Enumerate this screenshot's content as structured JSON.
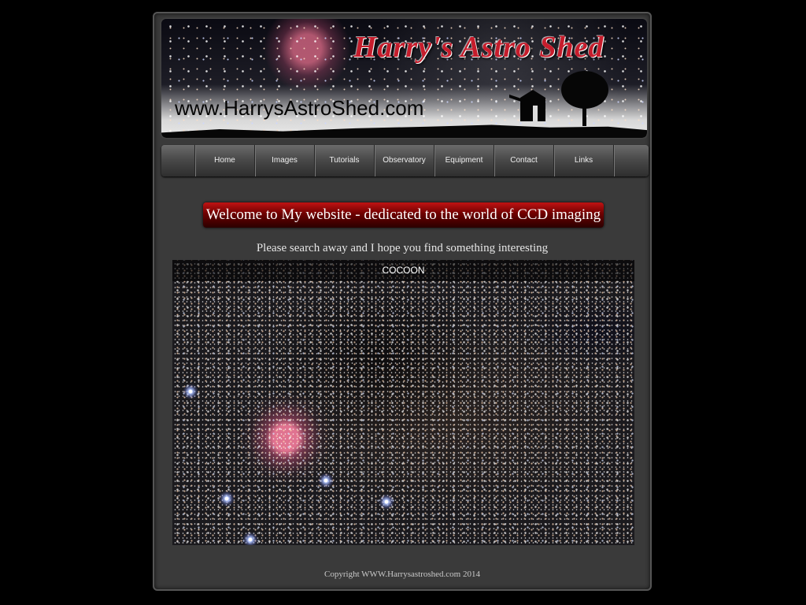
{
  "banner": {
    "title": "Harry's Astro Shed",
    "url": "www.HarrysAstroShed.com"
  },
  "nav": {
    "items": [
      "Home",
      "Images",
      "Tutorials",
      "Observatory",
      "Equipment",
      "Contact",
      "Links"
    ]
  },
  "main": {
    "welcome": "Welcome to My website - dedicated to the world of CCD imaging",
    "subtitle": "Please search away and I hope you find something interesting",
    "slideshow_caption": "COCOON"
  },
  "footer": {
    "copyright": "Copyright WWW.Harrysastroshed.com 2014"
  },
  "colors": {
    "background": "#000000",
    "page": "#3a3a3a",
    "title_red": "#c61d2c",
    "welcome_bar": "#8a0a0a",
    "text": "#e6e6e6"
  },
  "icons": [
    "observatory-shed-silhouette-icon",
    "tree-silhouette-icon"
  ]
}
